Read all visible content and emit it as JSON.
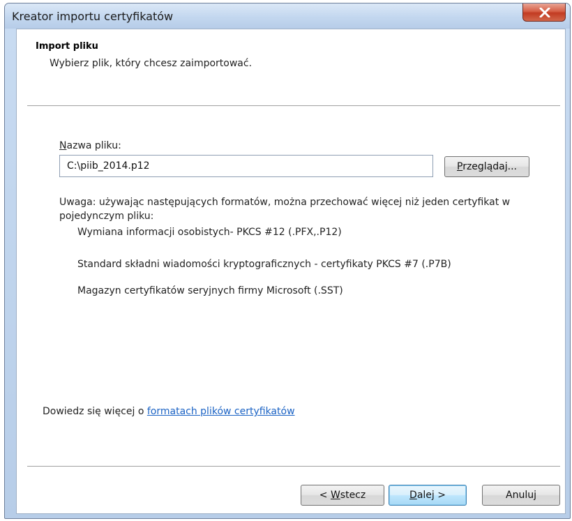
{
  "window": {
    "title": "Kreator importu certyfikatów"
  },
  "header": {
    "title": "Import pliku",
    "subtitle": "Wybierz plik, który chcesz zaimportować."
  },
  "file": {
    "label_mnemonic": "N",
    "label_rest": "azwa pliku:",
    "value": "C:\\piib_2014.p12",
    "browse_mnemonic": "P",
    "browse_rest": "rzeglądaj..."
  },
  "note": {
    "text": "Uwaga: używając następujących formatów, można przechować więcej niż jeden certyfikat w pojedynczym pliku:",
    "formats": [
      "Wymiana informacji osobistych- PKCS #12 (.PFX,.P12)",
      "Standard składni wiadomości kryptograficznych - certyfikaty PKCS #7 (.P7B)",
      "Magazyn certyfikatów seryjnych firmy Microsoft (.SST)"
    ]
  },
  "learn_more": {
    "prefix": "Dowiedz się więcej o ",
    "link": "formatach plików certyfikatów"
  },
  "buttons": {
    "back_prefix": "< ",
    "back_mnemonic": "W",
    "back_rest": "stecz",
    "next_mnemonic": "D",
    "next_rest": "alej >",
    "cancel": "Anuluj"
  },
  "colors": {
    "link": "#1a62c4",
    "close_button": "#c23b22",
    "title_bar": "#c3d7ef"
  }
}
